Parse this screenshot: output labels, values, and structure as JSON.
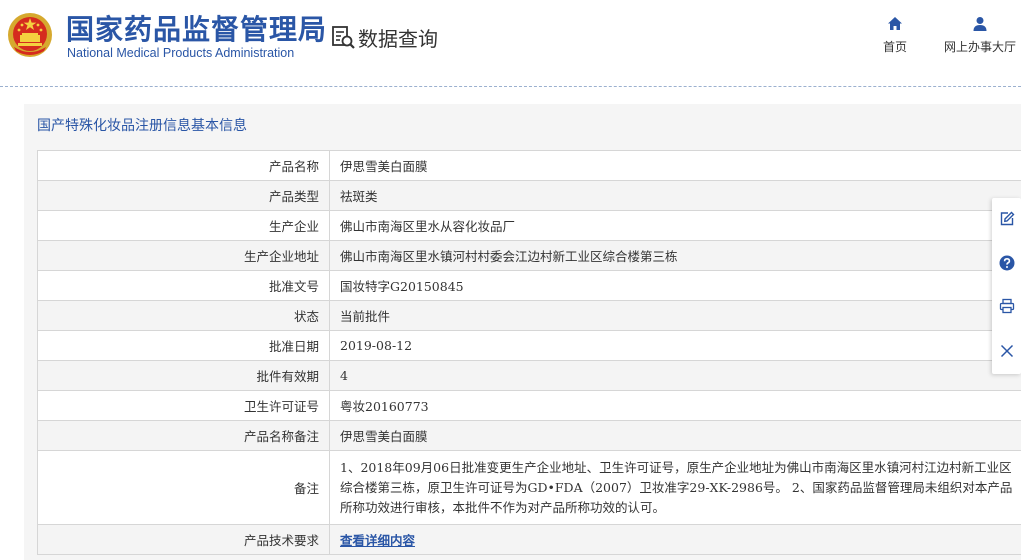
{
  "header": {
    "org_name_cn": "国家药品监督管理局",
    "org_name_en": "National Medical Products Administration",
    "query_label": "数据查询",
    "nav": {
      "home": "首页",
      "online_hall": "网上办事大厅"
    }
  },
  "panel": {
    "title": "国产特殊化妆品注册信息基本信息",
    "rows": [
      {
        "label": "产品名称",
        "value": "伊思雪美白面膜"
      },
      {
        "label": "产品类型",
        "value": "祛斑类"
      },
      {
        "label": "生产企业",
        "value": "佛山市南海区里水从容化妆品厂"
      },
      {
        "label": "生产企业地址",
        "value": "佛山市南海区里水镇河村村委会江边村新工业区综合楼第三栋"
      },
      {
        "label": "批准文号",
        "value": "国妆特字G20150845"
      },
      {
        "label": "状态",
        "value": "当前批件"
      },
      {
        "label": "批准日期",
        "value": "2019-08-12"
      },
      {
        "label": "批件有效期",
        "value": "4"
      },
      {
        "label": "卫生许可证号",
        "value": "粤妆20160773"
      },
      {
        "label": "产品名称备注",
        "value": "伊思雪美白面膜"
      },
      {
        "label": "备注",
        "value": "1、2018年09月06日批准变更生产企业地址、卫生许可证号，原生产企业地址为佛山市南海区里水镇河村江边村新工业区综合楼第三栋，原卫生许可证号为GD•FDA（2007）卫妆准字29-XK-2986号。 2、国家药品监督管理局未组织对本产品所称功效进行审核，本批件不作为对产品所称功效的认可。"
      },
      {
        "label": "产品技术要求",
        "value": "查看详细内容"
      }
    ]
  },
  "colors": {
    "brand_blue": "#2a56a6",
    "row_alt": "#f4f4f4",
    "panel_bg": "#f5f5f5"
  },
  "icons": {
    "emblem": "national-emblem-icon",
    "query": "document-search-icon",
    "home": "home-icon",
    "user": "user-icon",
    "side": [
      "edit-icon",
      "help-icon",
      "print-icon",
      "close-icon"
    ]
  }
}
